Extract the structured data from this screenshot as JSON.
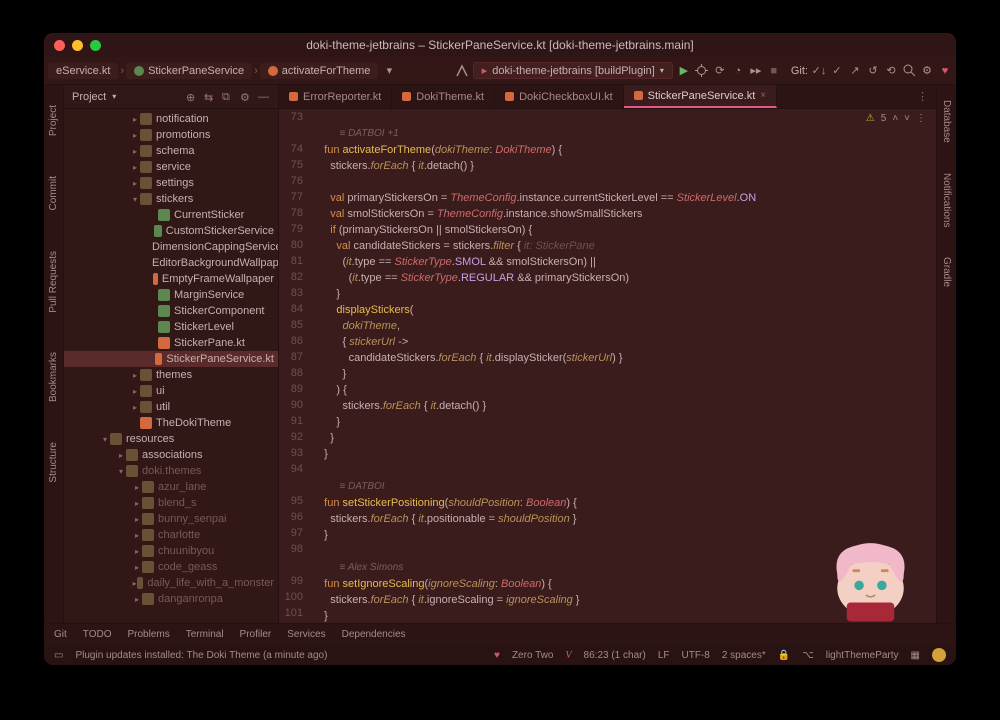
{
  "window": {
    "title": "doki-theme-jetbrains – StickerPaneService.kt [doki-theme-jetbrains.main]"
  },
  "breadcrumbs": [
    {
      "label": "eService.kt"
    },
    {
      "label": "StickerPaneService"
    },
    {
      "label": "activateForTheme"
    }
  ],
  "runconfig": "doki-theme-jetbrains [buildPlugin]",
  "git_label": "Git:",
  "left_tabs": [
    "Project",
    "Commit",
    "Pull Requests",
    "Bookmarks",
    "Structure"
  ],
  "right_tabs": [
    "Database",
    "Notifications",
    "Gradle"
  ],
  "project": {
    "title": "Project",
    "tree": [
      {
        "pad": 66,
        "arrow": "▸",
        "icon": "folder",
        "label": "notification"
      },
      {
        "pad": 66,
        "arrow": "▸",
        "icon": "folder",
        "label": "promotions"
      },
      {
        "pad": 66,
        "arrow": "▸",
        "icon": "folder",
        "label": "schema"
      },
      {
        "pad": 66,
        "arrow": "▸",
        "icon": "folder",
        "label": "service"
      },
      {
        "pad": 66,
        "arrow": "▸",
        "icon": "folder",
        "label": "settings"
      },
      {
        "pad": 66,
        "arrow": "▾",
        "icon": "folder",
        "label": "stickers"
      },
      {
        "pad": 84,
        "arrow": "",
        "icon": "cfile",
        "label": "CurrentSticker"
      },
      {
        "pad": 84,
        "arrow": "",
        "icon": "cfile",
        "label": "CustomStickerService"
      },
      {
        "pad": 84,
        "arrow": "",
        "icon": "cfile",
        "label": "DimensionCappingService"
      },
      {
        "pad": 84,
        "arrow": "",
        "icon": "kfile",
        "label": "EditorBackgroundWallpaper"
      },
      {
        "pad": 84,
        "arrow": "",
        "icon": "kfile",
        "label": "EmptyFrameWallpaper"
      },
      {
        "pad": 84,
        "arrow": "",
        "icon": "cfile",
        "label": "MarginService"
      },
      {
        "pad": 84,
        "arrow": "",
        "icon": "cfile",
        "label": "StickerComponent"
      },
      {
        "pad": 84,
        "arrow": "",
        "icon": "cfile",
        "label": "StickerLevel"
      },
      {
        "pad": 84,
        "arrow": "",
        "icon": "kfile",
        "label": "StickerPane.kt"
      },
      {
        "pad": 84,
        "arrow": "",
        "icon": "kfile",
        "label": "StickerPaneService.kt",
        "sel": true
      },
      {
        "pad": 66,
        "arrow": "▸",
        "icon": "folder",
        "label": "themes"
      },
      {
        "pad": 66,
        "arrow": "▸",
        "icon": "folder",
        "label": "ui"
      },
      {
        "pad": 66,
        "arrow": "▸",
        "icon": "folder",
        "label": "util"
      },
      {
        "pad": 66,
        "arrow": "",
        "icon": "kfile",
        "label": "TheDokiTheme"
      },
      {
        "pad": 36,
        "arrow": "▾",
        "icon": "folder",
        "label": "resources"
      },
      {
        "pad": 52,
        "arrow": "▸",
        "icon": "folder",
        "label": "associations"
      },
      {
        "pad": 52,
        "arrow": "▾",
        "icon": "folder",
        "label": "doki.themes",
        "dim": true
      },
      {
        "pad": 68,
        "arrow": "▸",
        "icon": "folder",
        "label": "azur_lane",
        "dim": true
      },
      {
        "pad": 68,
        "arrow": "▸",
        "icon": "folder",
        "label": "blend_s",
        "dim": true
      },
      {
        "pad": 68,
        "arrow": "▸",
        "icon": "folder",
        "label": "bunny_senpai",
        "dim": true
      },
      {
        "pad": 68,
        "arrow": "▸",
        "icon": "folder",
        "label": "charlotte",
        "dim": true
      },
      {
        "pad": 68,
        "arrow": "▸",
        "icon": "folder",
        "label": "chuunibyou",
        "dim": true
      },
      {
        "pad": 68,
        "arrow": "▸",
        "icon": "folder",
        "label": "code_geass",
        "dim": true
      },
      {
        "pad": 68,
        "arrow": "▸",
        "icon": "folder",
        "label": "daily_life_with_a_monster",
        "dim": true
      },
      {
        "pad": 68,
        "arrow": "▸",
        "icon": "folder",
        "label": "danganronpa",
        "dim": true
      }
    ]
  },
  "editor_tabs": [
    {
      "label": "ErrorReporter.kt",
      "active": false
    },
    {
      "label": "DokiTheme.kt",
      "active": false
    },
    {
      "label": "DokiCheckboxUI.kt",
      "active": false
    },
    {
      "label": "StickerPaneService.kt",
      "active": true
    }
  ],
  "inspection_count": "5",
  "code_lines": [
    {
      "n": "73",
      "h": ""
    },
    {
      "n": "",
      "h": "        <span class='ann'>≡ DATBOI +1</span>"
    },
    {
      "n": "74",
      "h": "   <span class='kw'>fun</span> <span class='fn'>activateForTheme</span>(<span class='it'>dokiTheme</span>: <span class='ty'>DokiTheme</span>) {"
    },
    {
      "n": "75",
      "h": "     stickers.<span class='it'>forEach</span> { <span class='it'>it</span>.detach() }"
    },
    {
      "n": "76",
      "h": ""
    },
    {
      "n": "77",
      "h": "     <span class='kw'>val</span> primaryStickersOn = <span class='ty'>ThemeConfig</span>.instance.currentStickerLevel <span class='op'>==</span> <span class='ty'>StickerLevel</span>.<span class='pr'>ON</span>"
    },
    {
      "n": "78",
      "h": "     <span class='kw'>val</span> smolStickersOn = <span class='ty'>ThemeConfig</span>.instance.showSmallStickers"
    },
    {
      "n": "79",
      "h": "     <span class='kw'>if</span> (primaryStickersOn || smolStickersOn) {"
    },
    {
      "n": "80",
      "h": "       <span class='kw'>val</span> candidateStickers = stickers.<span class='it'>filter</span> { <span class='co'>it: StickerPane</span>"
    },
    {
      "n": "81",
      "h": "         (<span class='it'>it</span>.type <span class='op'>==</span> <span class='ty'>StickerType</span>.<span class='pr'>SMOL</span> <span class='op'>&&</span> smolStickersOn) ||"
    },
    {
      "n": "82",
      "h": "           (<span class='it'>it</span>.type <span class='op'>==</span> <span class='ty'>StickerType</span>.<span class='pr'>REGULAR</span> <span class='op'>&&</span> primaryStickersOn)"
    },
    {
      "n": "83",
      "h": "       }"
    },
    {
      "n": "84",
      "h": "       <span class='fn'>displayStickers</span>("
    },
    {
      "n": "85",
      "h": "         <span class='it'>dokiTheme</span>,"
    },
    {
      "n": "86",
      "h": "         { <span class='it'>stickerUrl</span> <span class='op'>-&gt;</span>"
    },
    {
      "n": "87",
      "h": "           candidateStickers.<span class='it'>forEach</span> { <span class='it'>it</span>.displaySticker(<span class='it'>stickerUrl</span>) }"
    },
    {
      "n": "88",
      "h": "         }"
    },
    {
      "n": "89",
      "h": "       ) {"
    },
    {
      "n": "90",
      "h": "         stickers.<span class='it'>forEach</span> { <span class='it'>it</span>.detach() }"
    },
    {
      "n": "91",
      "h": "       }"
    },
    {
      "n": "92",
      "h": "     }"
    },
    {
      "n": "93",
      "h": "   }"
    },
    {
      "n": "94",
      "h": ""
    },
    {
      "n": "",
      "h": "        <span class='ann'>≡ DATBOI</span>"
    },
    {
      "n": "95",
      "h": "   <span class='kw'>fun</span> <span class='fn'>setStickerPositioning</span>(<span class='it'>shouldPosition</span>: <span class='ty'>Boolean</span>) {"
    },
    {
      "n": "96",
      "h": "     stickers.<span class='it'>forEach</span> { <span class='it'>it</span>.positionable = <span class='it'>shouldPosition</span> }"
    },
    {
      "n": "97",
      "h": "   }"
    },
    {
      "n": "98",
      "h": ""
    },
    {
      "n": "",
      "h": "        <span class='ann'>≡ Alex Simons</span>"
    },
    {
      "n": "99",
      "h": "   <span class='kw'>fun</span> <span class='fn'>setIgnoreScaling</span>(<span class='it'>ignoreScaling</span>: <span class='ty'>Boolean</span>) {"
    },
    {
      "n": "100",
      "h": "     stickers.<span class='it'>forEach</span> { <span class='it'>it</span>.ignoreScaling = <span class='it'>ignoreScaling</span> }"
    },
    {
      "n": "101",
      "h": "   }"
    },
    {
      "n": "102",
      "h": ""
    }
  ],
  "bottom": [
    {
      "label": "Git"
    },
    {
      "label": "TODO"
    },
    {
      "label": "Problems"
    },
    {
      "label": "Terminal"
    },
    {
      "label": "Profiler"
    },
    {
      "label": "Services"
    },
    {
      "label": "Dependencies"
    }
  ],
  "status": {
    "msg": "Plugin updates installed: The Doki Theme (a minute ago)",
    "theme": "Zero Two",
    "pos": "86:23 (1 char)",
    "le": "LF",
    "enc": "UTF-8",
    "ind": "2 spaces*",
    "branch": "lightThemeParty"
  }
}
